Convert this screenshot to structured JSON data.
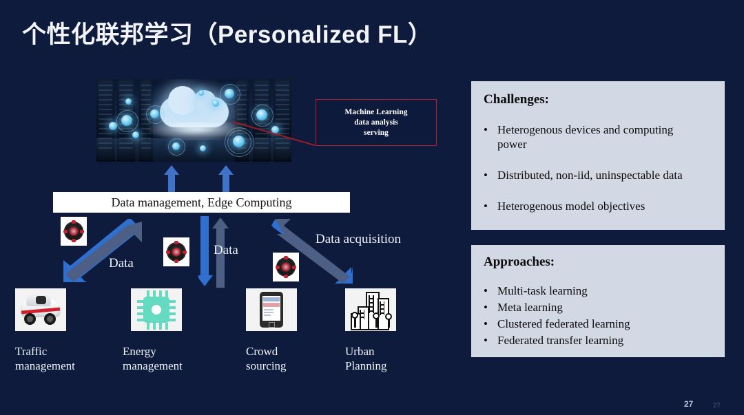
{
  "slide": {
    "title": "个性化联邦学习（Personalized FL）",
    "page_number": "27",
    "page_number_ghost": "27",
    "background_color": "#0e1b3d"
  },
  "diagram": {
    "cloud_photo_name": "datacenter-cloud-photo",
    "callout": {
      "line1": "Machine Learning",
      "line2": "data analysis",
      "line3": "serving",
      "border_color": "#b2202f"
    },
    "middle_bar": {
      "label": "Data management, Edge Computing",
      "background_color": "#ffffff"
    },
    "flow_labels": [
      {
        "text": "Data"
      },
      {
        "text": "Data"
      },
      {
        "text": "Data acquisition"
      }
    ],
    "arrow_colors": {
      "outgoing": "#2f6fd0",
      "incoming": "#4d5f85",
      "upload": "#3f72c8"
    },
    "hub_icons": [
      {
        "name": "network-hub-icon"
      },
      {
        "name": "network-hub-icon"
      },
      {
        "name": "network-hub-icon"
      }
    ],
    "applications": [
      {
        "icon": "toy-car-icon",
        "label_line1": "Traffic",
        "label_line2": "management"
      },
      {
        "icon": "cpu-chip-icon",
        "label_line1": "Energy",
        "label_line2": "management"
      },
      {
        "icon": "tablet-icon",
        "label_line1": "Crowd",
        "label_line2": "sourcing"
      },
      {
        "icon": "city-skyline-icon",
        "label_line1": "Urban",
        "label_line2": "Planning"
      }
    ]
  },
  "panels": [
    {
      "title": "Challenges:",
      "bullet": "•",
      "items": [
        "Heterogenous devices and computing power",
        "Distributed, non-iid, uninspectable data",
        "Heterogenous model objectives"
      ]
    },
    {
      "title": "Approaches:",
      "bullet": "•",
      "items": [
        "Multi-task learning",
        "Meta learning",
        "Clustered federated learning",
        "Federated transfer learning"
      ]
    }
  ]
}
